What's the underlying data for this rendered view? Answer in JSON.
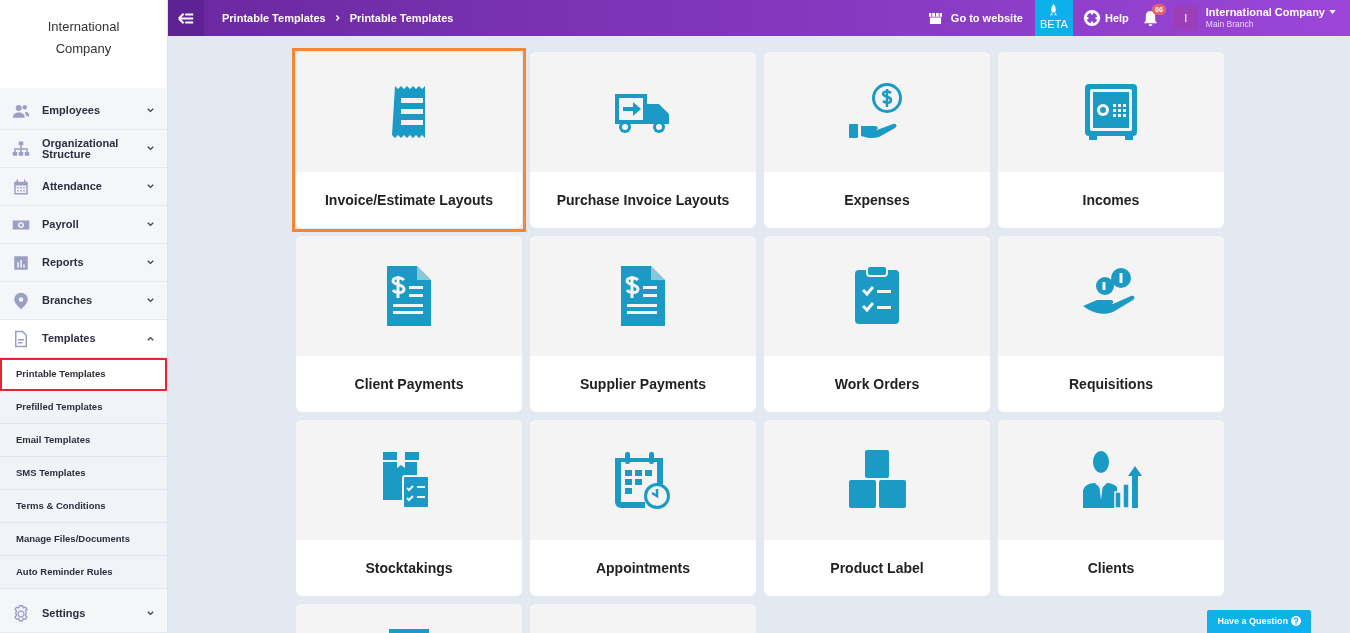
{
  "sidebar": {
    "company": "International Company",
    "items": [
      {
        "label": "Employees",
        "kind": "people",
        "expanded": false
      },
      {
        "label": "Organizational Structure",
        "kind": "org",
        "expanded": false
      },
      {
        "label": "Attendance",
        "kind": "calendar",
        "expanded": false
      },
      {
        "label": "Payroll",
        "kind": "cash",
        "expanded": false
      },
      {
        "label": "Reports",
        "kind": "chart",
        "expanded": false
      },
      {
        "label": "Branches",
        "kind": "pin",
        "expanded": false
      },
      {
        "label": "Templates",
        "kind": "doc",
        "expanded": true,
        "children": [
          {
            "label": "Printable Templates",
            "selected": true
          },
          {
            "label": "Prefilled Templates",
            "selected": false
          },
          {
            "label": "Email Templates",
            "selected": false
          },
          {
            "label": "SMS Templates",
            "selected": false
          },
          {
            "label": "Terms & Conditions",
            "selected": false
          },
          {
            "label": "Manage Files/Documents",
            "selected": false
          },
          {
            "label": "Auto Reminder Rules",
            "selected": false
          }
        ]
      },
      {
        "label": "Settings",
        "kind": "gear",
        "expanded": false
      }
    ]
  },
  "topbar": {
    "breadcrumb": [
      "Printable Templates",
      "Printable Templates"
    ],
    "website": "Go to website",
    "beta": "BETA",
    "help": "Help",
    "notifications": "66",
    "avatar": "I",
    "account": "International Company",
    "branch": "Main Branch"
  },
  "cards": [
    {
      "label": "Invoice/Estimate Layouts",
      "kind": "receipt",
      "selected": true
    },
    {
      "label": "Purchase Invoice Layouts",
      "kind": "truck",
      "selected": false
    },
    {
      "label": "Expenses",
      "kind": "money",
      "selected": false
    },
    {
      "label": "Incomes",
      "kind": "safe",
      "selected": false
    },
    {
      "label": "Client Payments",
      "kind": "dollardoc",
      "selected": false
    },
    {
      "label": "Supplier Payments",
      "kind": "dollardoc",
      "selected": false
    },
    {
      "label": "Work Orders",
      "kind": "clipboard",
      "selected": false
    },
    {
      "label": "Requisitions",
      "kind": "coins",
      "selected": false
    },
    {
      "label": "Stocktakings",
      "kind": "boxlist",
      "selected": false
    },
    {
      "label": "Appointments",
      "kind": "schedule",
      "selected": false
    },
    {
      "label": "Product Label",
      "kind": "boxes",
      "selected": false
    },
    {
      "label": "Clients",
      "kind": "person",
      "selected": false
    },
    {
      "kind": "partial",
      "selected": false
    },
    {
      "kind": "blank",
      "selected": false
    }
  ],
  "help_button": "Have a Question"
}
